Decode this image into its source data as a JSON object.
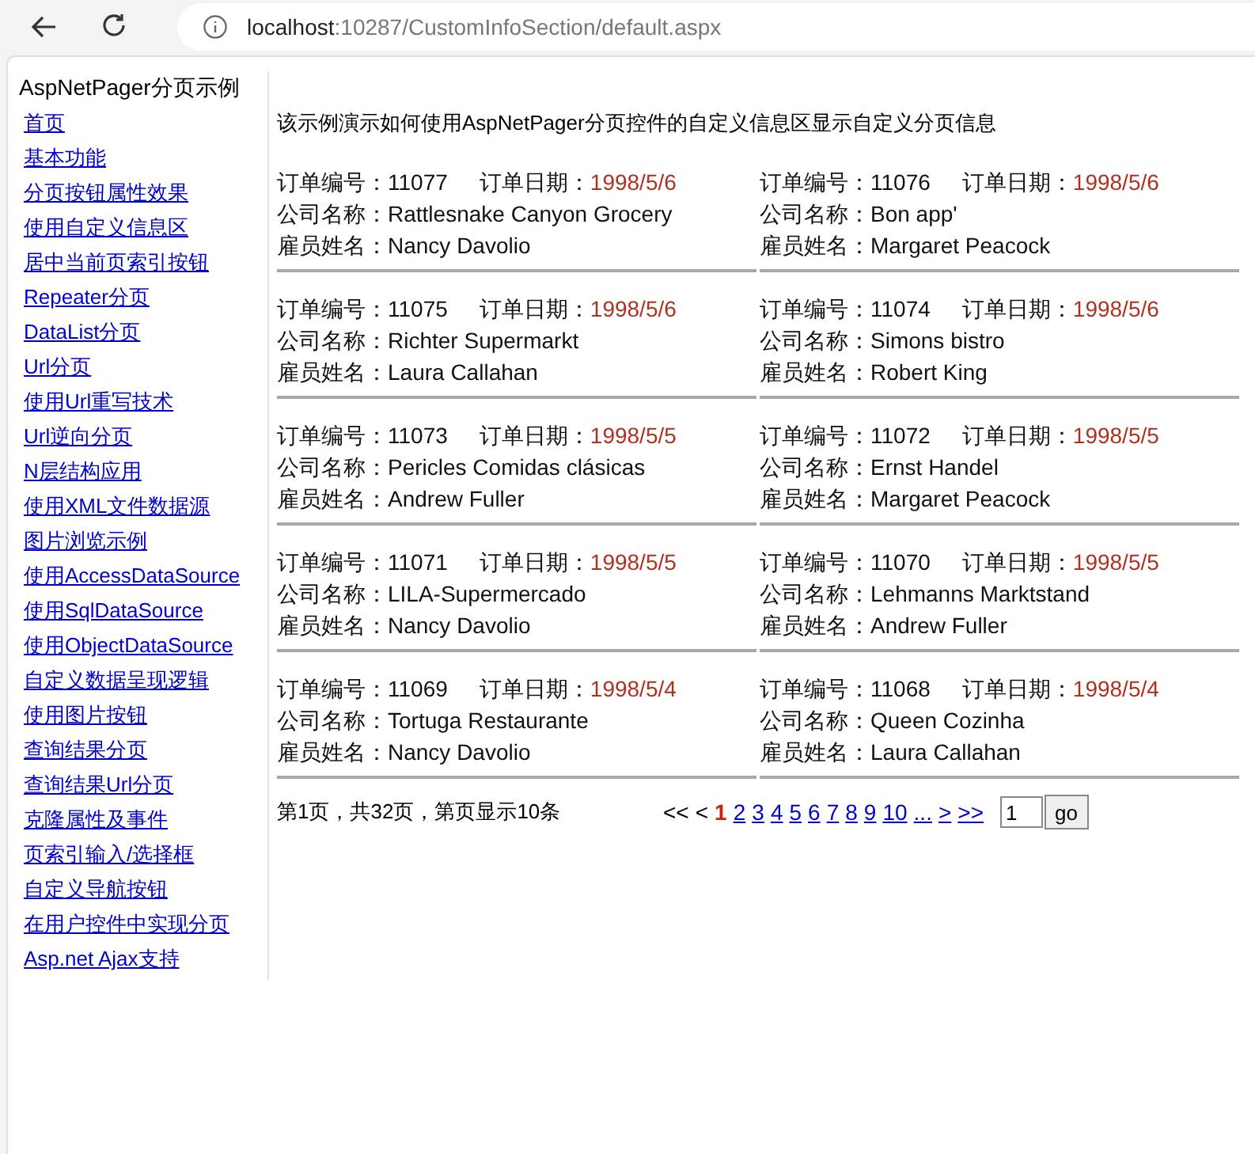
{
  "browser": {
    "url_host": "localhost",
    "url_rest": ":10287/CustomInfoSection/default.aspx"
  },
  "sidebar": {
    "title": "AspNetPager分页示例",
    "links": [
      "首页",
      "基本功能",
      "分页按钮属性效果",
      "使用自定义信息区",
      "居中当前页索引按钮",
      "Repeater分页",
      "DataList分页",
      "Url分页",
      "使用Url重写技术",
      "Url逆向分页",
      "N层结构应用",
      "使用XML文件数据源",
      "图片浏览示例",
      "使用AccessDataSource",
      "使用SqlDataSource",
      "使用ObjectDataSource",
      "自定义数据呈现逻辑",
      "使用图片按钮",
      "查询结果分页",
      "查询结果Url分页",
      "克隆属性及事件",
      "页索引输入/选择框",
      "自定义导航按钮",
      "在用户控件中实现分页",
      "Asp.net Ajax支持"
    ]
  },
  "main": {
    "intro": "该示例演示如何使用AspNetPager分页控件的自定义信息区显示自定义分页信息",
    "records": [
      {
        "order_label": "订单编号：",
        "order_no": "11077",
        "date_label": "订单日期：",
        "date": "1998/5/6",
        "company_label": "公司名称：",
        "company": "Rattlesnake Canyon Grocery",
        "employee_label": "雇员姓名：",
        "employee": "Nancy Davolio"
      },
      {
        "order_label": "订单编号：",
        "order_no": "11076",
        "date_label": "订单日期：",
        "date": "1998/5/6",
        "company_label": "公司名称：",
        "company": "Bon app'",
        "employee_label": "雇员姓名：",
        "employee": "Margaret Peacock"
      },
      {
        "order_label": "订单编号：",
        "order_no": "11075",
        "date_label": "订单日期：",
        "date": "1998/5/6",
        "company_label": "公司名称：",
        "company": "Richter Supermarkt",
        "employee_label": "雇员姓名：",
        "employee": "Laura Callahan"
      },
      {
        "order_label": "订单编号：",
        "order_no": "11074",
        "date_label": "订单日期：",
        "date": "1998/5/6",
        "company_label": "公司名称：",
        "company": "Simons bistro",
        "employee_label": "雇员姓名：",
        "employee": "Robert King"
      },
      {
        "order_label": "订单编号：",
        "order_no": "11073",
        "date_label": "订单日期：",
        "date": "1998/5/5",
        "company_label": "公司名称：",
        "company": "Pericles Comidas clásicas",
        "employee_label": "雇员姓名：",
        "employee": "Andrew Fuller"
      },
      {
        "order_label": "订单编号：",
        "order_no": "11072",
        "date_label": "订单日期：",
        "date": "1998/5/5",
        "company_label": "公司名称：",
        "company": "Ernst Handel",
        "employee_label": "雇员姓名：",
        "employee": "Margaret Peacock"
      },
      {
        "order_label": "订单编号：",
        "order_no": "11071",
        "date_label": "订单日期：",
        "date": "1998/5/5",
        "company_label": "公司名称：",
        "company": "LILA-Supermercado",
        "employee_label": "雇员姓名：",
        "employee": "Nancy Davolio"
      },
      {
        "order_label": "订单编号：",
        "order_no": "11070",
        "date_label": "订单日期：",
        "date": "1998/5/5",
        "company_label": "公司名称：",
        "company": "Lehmanns Marktstand",
        "employee_label": "雇员姓名：",
        "employee": "Andrew Fuller"
      },
      {
        "order_label": "订单编号：",
        "order_no": "11069",
        "date_label": "订单日期：",
        "date": "1998/5/4",
        "company_label": "公司名称：",
        "company": "Tortuga Restaurante",
        "employee_label": "雇员姓名：",
        "employee": "Nancy Davolio"
      },
      {
        "order_label": "订单编号：",
        "order_no": "11068",
        "date_label": "订单日期：",
        "date": "1998/5/4",
        "company_label": "公司名称：",
        "company": "Queen Cozinha",
        "employee_label": "雇员姓名：",
        "employee": "Laura Callahan"
      }
    ],
    "pager": {
      "summary": "第1页，共32页，第页显示10条",
      "items": [
        {
          "label": "<<",
          "kind": "disabled"
        },
        {
          "label": "<",
          "kind": "disabled"
        },
        {
          "label": "1",
          "kind": "current"
        },
        {
          "label": "2",
          "kind": "link"
        },
        {
          "label": "3",
          "kind": "link"
        },
        {
          "label": "4",
          "kind": "link"
        },
        {
          "label": "5",
          "kind": "link"
        },
        {
          "label": "6",
          "kind": "link"
        },
        {
          "label": "7",
          "kind": "link"
        },
        {
          "label": "8",
          "kind": "link"
        },
        {
          "label": "9",
          "kind": "link"
        },
        {
          "label": "10",
          "kind": "link"
        },
        {
          "label": "...",
          "kind": "link"
        },
        {
          "label": ">",
          "kind": "link"
        },
        {
          "label": ">>",
          "kind": "link"
        }
      ],
      "page_input": "1",
      "go_button": "go"
    }
  }
}
